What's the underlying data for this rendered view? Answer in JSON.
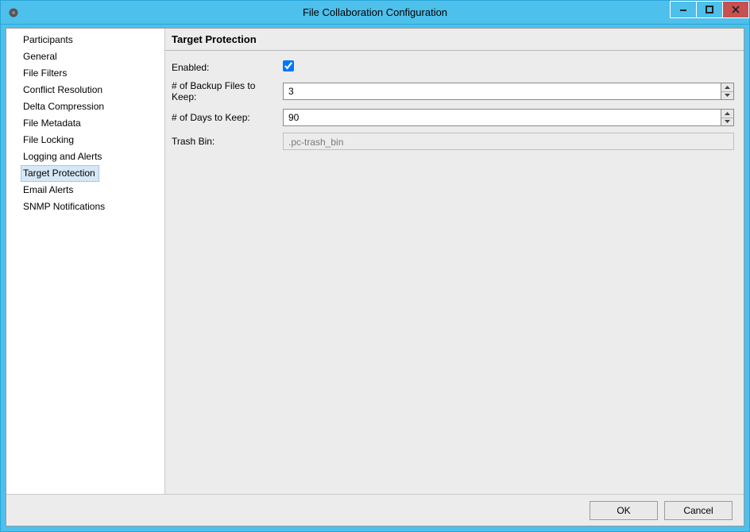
{
  "window": {
    "title": "File Collaboration Configuration"
  },
  "sidebar": {
    "items": [
      {
        "label": "Participants",
        "selected": false
      },
      {
        "label": "General",
        "selected": false
      },
      {
        "label": "File Filters",
        "selected": false
      },
      {
        "label": "Conflict Resolution",
        "selected": false
      },
      {
        "label": "Delta Compression",
        "selected": false
      },
      {
        "label": "File Metadata",
        "selected": false
      },
      {
        "label": "File Locking",
        "selected": false
      },
      {
        "label": "Logging and Alerts",
        "selected": false
      },
      {
        "label": "Target Protection",
        "selected": true
      },
      {
        "label": "Email Alerts",
        "selected": false
      },
      {
        "label": "SNMP Notifications",
        "selected": false
      }
    ]
  },
  "main": {
    "section_title": "Target Protection",
    "fields": {
      "enabled_label": "Enabled:",
      "enabled_checked": true,
      "backup_label": "# of Backup Files to Keep:",
      "backup_value": "3",
      "days_label": "# of Days to Keep:",
      "days_value": "90",
      "trash_label": "Trash Bin:",
      "trash_value": ".pc-trash_bin"
    }
  },
  "buttons": {
    "ok": "OK",
    "cancel": "Cancel"
  }
}
